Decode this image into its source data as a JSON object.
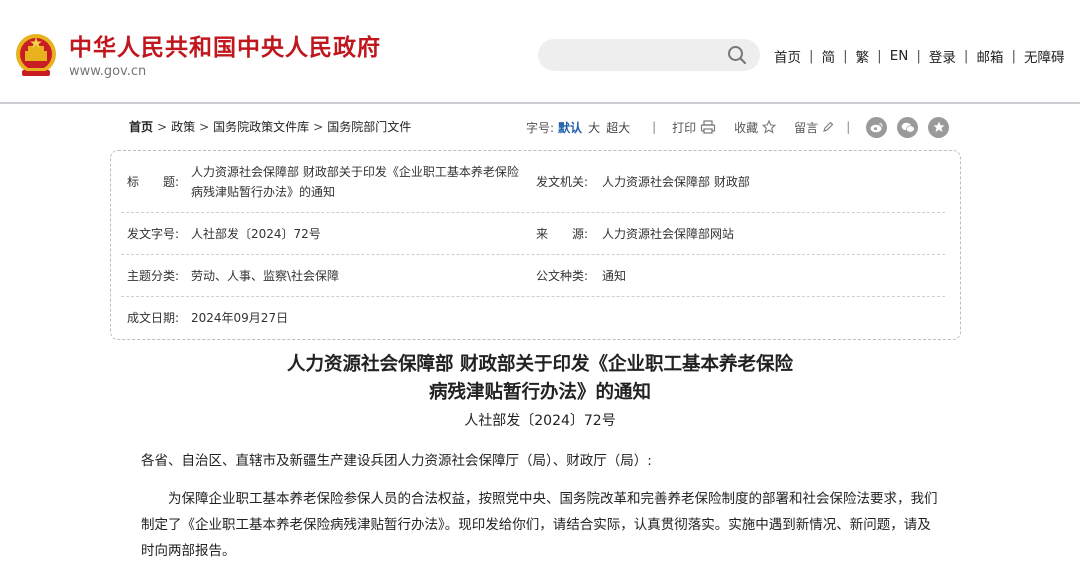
{
  "header": {
    "site_name": "中华人民共和国中央人民政府",
    "site_url": "www.gov.cn",
    "colors": {
      "brand_red": "#c0171e",
      "emblem_gold": "#e8b21d",
      "link_blue": "#1f5fad"
    },
    "search": {
      "value": "",
      "icon": "search-icon"
    },
    "nav": [
      "首页",
      "简",
      "繁",
      "EN",
      "登录",
      "邮箱",
      "无障碍"
    ]
  },
  "breadcrumb": [
    "首页",
    "政策",
    "国务院政策文件库",
    "国务院部门文件"
  ],
  "tools": {
    "font_size_label": "字号:",
    "font_sizes": [
      "默认",
      "大",
      "超大"
    ],
    "print_label": "打印",
    "favorite_label": "收藏",
    "comment_label": "留言",
    "share_icons": [
      "weibo-icon",
      "wechat-icon",
      "star-share-icon"
    ]
  },
  "info": {
    "title_key": "标　　题:",
    "title_val": "人力资源社会保障部 财政部关于印发《企业职工基本养老保险 病残津贴暂行办法》的通知",
    "issuer_key": "发文机关:",
    "issuer_val": "人力资源社会保障部 财政部",
    "docno_key": "发文字号:",
    "docno_val": "人社部发〔2024〕72号",
    "source_key": "来　　源:",
    "source_val": "人力资源社会保障部网站",
    "topic_key": "主题分类:",
    "topic_val": "劳动、人事、监察\\社会保障",
    "type_key": "公文种类:",
    "type_val": "通知",
    "date_key": "成文日期:",
    "date_val": "2024年09月27日"
  },
  "article": {
    "title_line1": "人力资源社会保障部 财政部关于印发《企业职工基本养老保险",
    "title_line2": "病残津贴暂行办法》的通知",
    "doc_number": "人社部发〔2024〕72号",
    "salutation": "各省、自治区、直辖市及新疆生产建设兵团人力资源社会保障厅（局）、财政厅（局）:",
    "body": "为保障企业职工基本养老保险参保人员的合法权益，按照党中央、国务院改革和完善养老保险制度的部署和社会保险法要求，我们制定了《企业职工基本养老保险病残津贴暂行办法》。现印发给你们，请结合实际，认真贯彻落实。实施中遇到新情况、新问题，请及时向两部报告。"
  }
}
